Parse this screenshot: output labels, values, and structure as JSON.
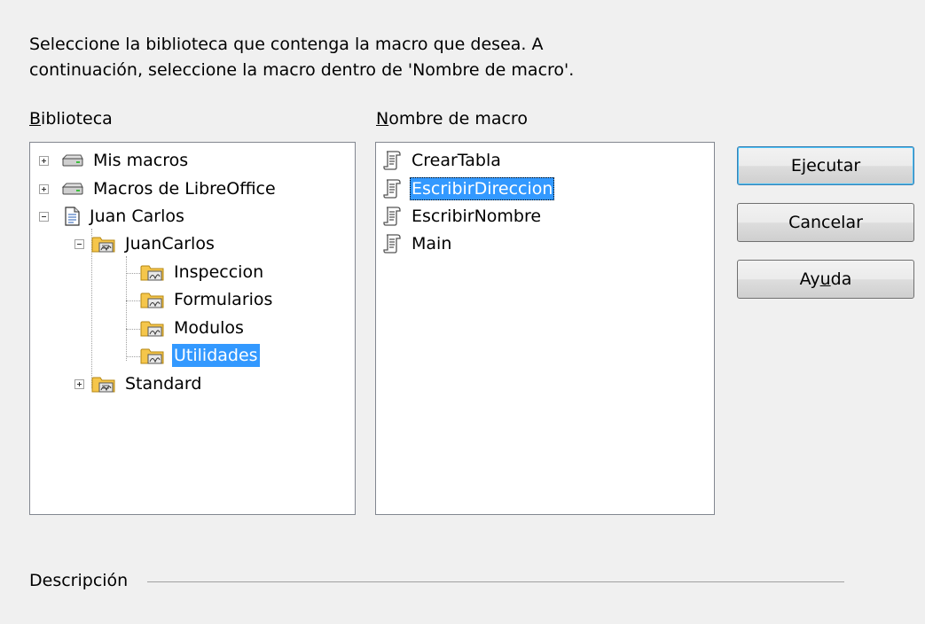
{
  "intro": {
    "line1": "Seleccione la biblioteca que contenga la macro que desea. A",
    "line2": "continuación, seleccione la macro dentro de 'Nombre de macro'."
  },
  "library": {
    "label_first": "B",
    "label_rest": "iblioteca",
    "items": [
      {
        "label": "Mis macros",
        "icon": "drive-icon",
        "expander": "plus"
      },
      {
        "label": "Macros de LibreOffice",
        "icon": "drive-icon",
        "expander": "plus"
      },
      {
        "label": "Juan Carlos",
        "icon": "document-icon",
        "expander": "minus"
      },
      {
        "label": "JuanCarlos",
        "icon": "library-folder-icon",
        "expander": "minus"
      },
      {
        "label": "Inspeccion",
        "icon": "module-folder-icon"
      },
      {
        "label": "Formularios",
        "icon": "module-folder-icon"
      },
      {
        "label": "Modulos",
        "icon": "module-folder-icon"
      },
      {
        "label": "Utilidades",
        "icon": "module-folder-icon",
        "selected": true
      },
      {
        "label": "Standard",
        "icon": "library-folder-icon",
        "expander": "plus"
      }
    ]
  },
  "macros": {
    "label_first": "N",
    "label_rest": "ombre de macro",
    "items": [
      {
        "label": "CrearTabla",
        "icon": "macro-scroll-icon"
      },
      {
        "label": "EscribirDireccion",
        "icon": "macro-scroll-icon",
        "selected": true
      },
      {
        "label": "EscribirNombre",
        "icon": "macro-scroll-icon"
      },
      {
        "label": "Main",
        "icon": "macro-scroll-icon"
      }
    ]
  },
  "buttons": {
    "run": "Ejecutar",
    "cancel": "Cancelar",
    "help_pre": "Ay",
    "help_u": "u",
    "help_post": "da"
  },
  "description": {
    "label": "Descripción"
  },
  "colors": {
    "selection": "#3399ff",
    "background": "#f0f0f0",
    "folder": "#f5c64b"
  }
}
